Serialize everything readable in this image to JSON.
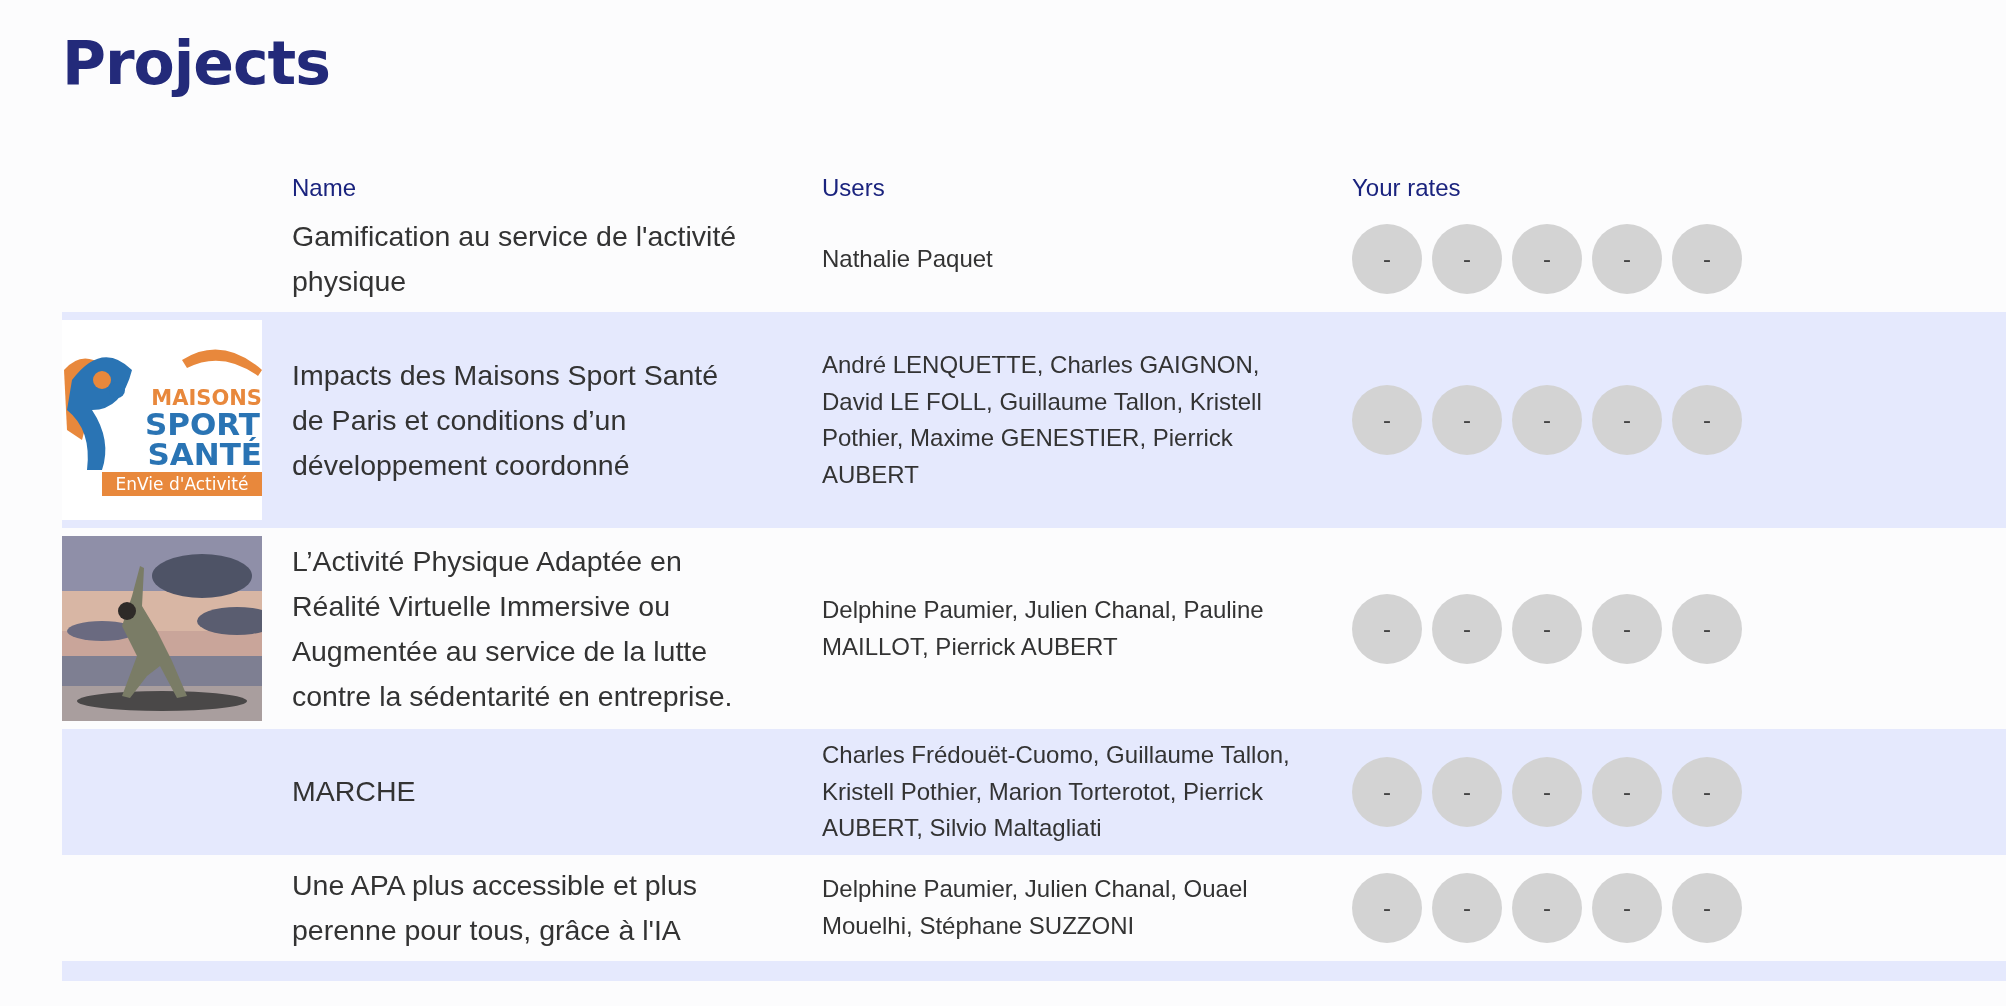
{
  "title": "Projects",
  "columns": [
    "Name",
    "Users",
    "Your rates"
  ],
  "rows": [
    {
      "image": {
        "kind": "none"
      },
      "name": "Gamification au service de l'activité physique",
      "users": "Nathalie Paquet",
      "rates": [
        "-",
        "-",
        "-",
        "-",
        "-"
      ]
    },
    {
      "image": {
        "kind": "logo",
        "lines": [
          "MAISONS",
          "SPORT",
          "SANTÉ",
          "EnVie d'Activité"
        ]
      },
      "name": "Impacts des Maisons Sport Santé de Paris et conditions d’un développement coordonné",
      "users": "André LENQUETTE, Charles GAIGNON, David LE FOLL, Guillaume Tallon, Kristell Pothier, Maxime GENESTIER, Pierrick AUBERT",
      "rates": [
        "-",
        "-",
        "-",
        "-",
        "-"
      ]
    },
    {
      "name": "L’Activité Physique Adaptée en Réalité Virtuelle Immersive ou Augmentée au service de la lutte contre la sédentarité en entreprise.",
      "users": "Delphine Paumier, Julien Chanal, Pauline MAILLOT, Pierrick AUBERT",
      "rates": [
        "-",
        "-",
        "-",
        "-",
        "-"
      ]
    },
    {
      "image": {
        "kind": "none"
      },
      "name": "MARCHE",
      "users": "Charles Frédouët-Cuomo, Guillaume Tallon, Kristell Pothier, Marion Torterotot, Pierrick AUBERT, Silvio Maltagliati",
      "rates": [
        "-",
        "-",
        "-",
        "-",
        "-"
      ]
    },
    {
      "image": {
        "kind": "none"
      },
      "name": "Une APA plus accessible et plus perenne pour tous, grâce à l'IA",
      "users": "Delphine Paumier, Julien Chanal, Ouael Mouelhi, Stéphane SUZZONI",
      "rates": [
        "-",
        "-",
        "-",
        "-",
        "-"
      ]
    }
  ]
}
